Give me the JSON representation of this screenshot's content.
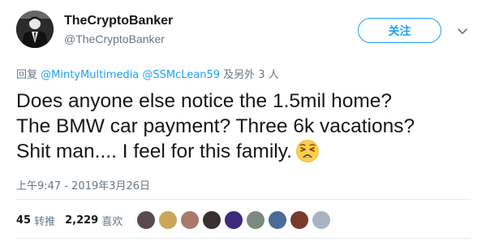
{
  "author": {
    "display_name": "TheCryptoBanker",
    "handle": "@TheCryptoBanker",
    "avatar_icon": "suited-man-avatar"
  },
  "follow_button": {
    "label": "关注"
  },
  "menu": {
    "icon": "chevron-down-icon"
  },
  "reply": {
    "prefix": "回复 ",
    "mentions": "@MintyMultimedia @SSMcLean59",
    "suffix": " 及另外 3 人"
  },
  "tweet": {
    "lines": [
      "Does anyone else notice the 1.5mil home?",
      "The BMW car payment? Three 6k vacations?",
      "Shit man.... I feel for this family."
    ],
    "emoji": "weary-face-icon"
  },
  "timestamp": "上午9:47 - 2019年3月26日",
  "stats": {
    "retweets_count": "45",
    "retweets_label": "转推",
    "likes_count": "2,229",
    "likes_label": "喜欢"
  },
  "likers": {
    "colors": [
      "#5a4a52",
      "#c9a65a",
      "#a87a6a",
      "#3a3030",
      "#3d2a7a",
      "#7a8a80",
      "#4a6a9a",
      "#7a3a2a",
      "#aab4c0"
    ]
  },
  "colors": {
    "accent": "#1da1f2",
    "secondary_text": "#657786",
    "primary_text": "#14171a"
  }
}
